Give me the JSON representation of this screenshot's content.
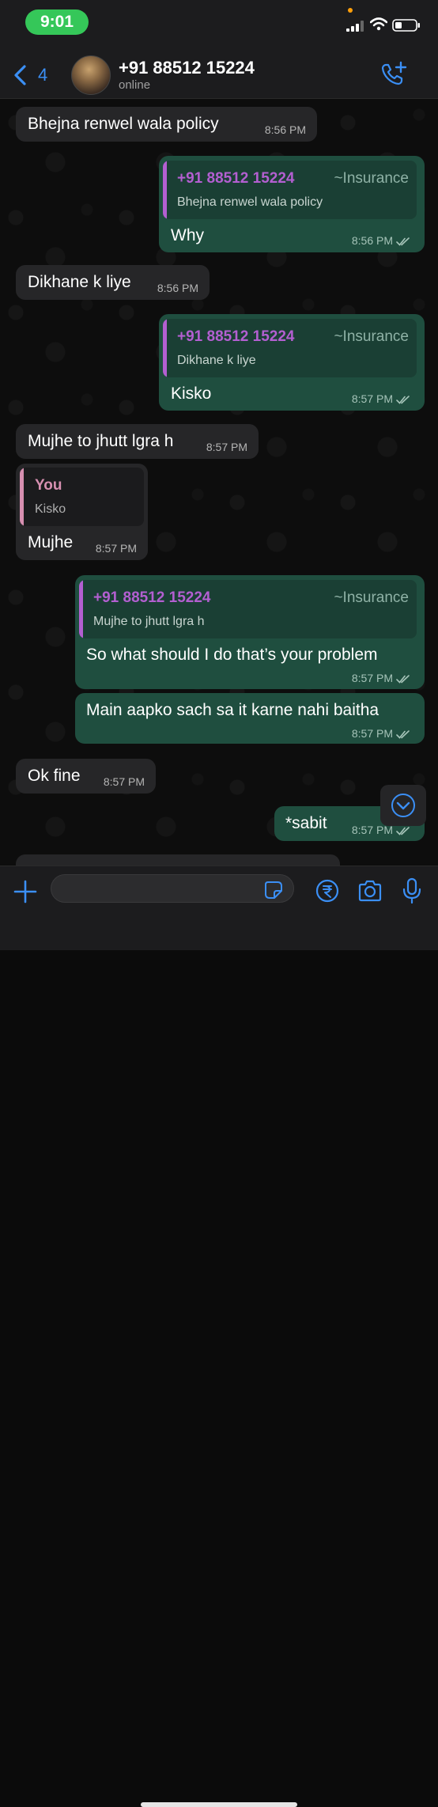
{
  "status_bar": {
    "time": "9:01"
  },
  "header": {
    "back_count": "4",
    "contact_name": "+91 88512 15224",
    "contact_status": "online"
  },
  "messages": [
    {
      "text": "Bhejna renwel wala policy",
      "time": "8:56 PM"
    },
    {
      "quote_name": "+91 88512 15224",
      "quote_tag": "~Insurance",
      "quote_text": "Bhejna renwel wala policy",
      "text": "Why",
      "time": "8:56 PM"
    },
    {
      "text": "Dikhane k liye",
      "time": "8:56 PM"
    },
    {
      "quote_name": "+91 88512 15224",
      "quote_tag": "~Insurance",
      "quote_text": "Dikhane k liye",
      "text": "Kisko",
      "time": "8:57 PM"
    },
    {
      "text": "Mujhe to jhutt lgra h",
      "time": "8:57 PM"
    },
    {
      "quote_name": "You",
      "quote_text": "Kisko",
      "text": "Mujhe",
      "time": "8:57 PM"
    },
    {
      "quote_name": "+91 88512 15224",
      "quote_tag": "~Insurance",
      "quote_text": "Mujhe to jhutt lgra h",
      "text": "So what should I do that’s your problem",
      "time": "8:57 PM"
    },
    {
      "text": "Main aapko sach sa it karne nahi baitha",
      "time": "8:57 PM"
    },
    {
      "text": "Ok fine",
      "time": "8:57 PM"
    },
    {
      "text": "*sabit",
      "time": "8:57 PM"
    }
  ],
  "input": {
    "placeholder": ""
  },
  "colors": {
    "accent_blue": "#3b8ff5",
    "outgoing_bubble": "#1f4e3f",
    "incoming_bubble": "#262628",
    "quote_purple": "#b35fd1",
    "quote_pink": "#d68fb0",
    "status_green": "#35c759"
  },
  "icons": [
    "back-chevron-icon",
    "call-add-icon",
    "scroll-down-icon",
    "plus-icon",
    "sticker-icon",
    "payment-icon",
    "camera-icon",
    "mic-icon",
    "read-check-icon"
  ]
}
